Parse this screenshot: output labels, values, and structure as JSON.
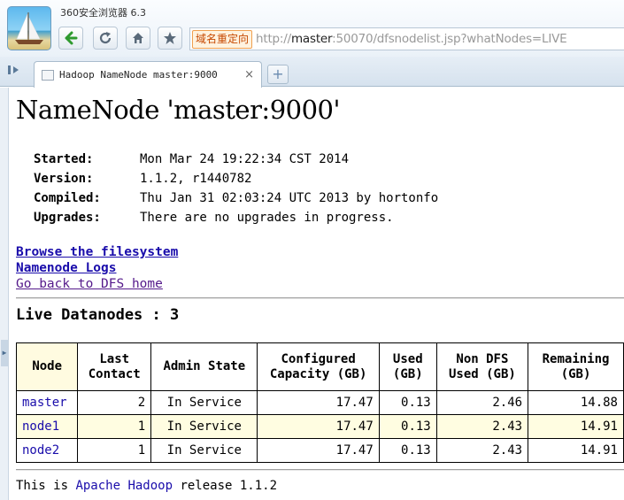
{
  "browser": {
    "title": "360安全浏览器 6.3",
    "redirect_badge": "域名重定向",
    "url_prefix": "http://",
    "url_host": "master",
    "url_rest": ":50070/dfsnodelist.jsp?whatNodes=LIVE",
    "tab_title": "Hadoop NameNode master:9000",
    "tab_close": "×",
    "new_tab": "+",
    "icons": {
      "back": "arrow-left-icon",
      "refresh": "refresh-icon",
      "home": "home-icon",
      "favorite": "star-icon"
    }
  },
  "page": {
    "title": "NameNode 'master:9000'",
    "info": [
      {
        "label": "Started:",
        "value": "Mon Mar 24 19:22:34 CST 2014"
      },
      {
        "label": "Version:",
        "value": "1.1.2, r1440782"
      },
      {
        "label": "Compiled:",
        "value": "Thu Jan 31 02:03:24 UTC 2013 by hortonfo"
      },
      {
        "label": "Upgrades:",
        "value": "There are no upgrades in progress."
      }
    ],
    "links": {
      "browse": "Browse the filesystem",
      "logs": "Namenode Logs",
      "dfs_home": "Go back to DFS home"
    },
    "section_title": "Live Datanodes : 3",
    "columns": {
      "node": "Node",
      "last_contact_1": "Last",
      "last_contact_2": "Contact",
      "admin_state": "Admin State",
      "configured_1": "Configured",
      "configured_2": "Capacity (GB)",
      "used_1": "Used",
      "used_2": "(GB)",
      "nondfs_1": "Non DFS",
      "nondfs_2": "Used (GB)",
      "remaining_1": "Remaining",
      "remaining_2": "(GB)"
    },
    "rows": [
      {
        "node": "master",
        "last_contact": "2",
        "admin_state": "In Service",
        "configured": "17.47",
        "used": "0.13",
        "non_dfs": "2.46",
        "remaining": "14.88"
      },
      {
        "node": "node1",
        "last_contact": "1",
        "admin_state": "In Service",
        "configured": "17.47",
        "used": "0.13",
        "non_dfs": "2.43",
        "remaining": "14.91"
      },
      {
        "node": "node2",
        "last_contact": "1",
        "admin_state": "In Service",
        "configured": "17.47",
        "used": "0.13",
        "non_dfs": "2.43",
        "remaining": "14.91"
      }
    ],
    "footer": {
      "prefix": "This is ",
      "link": "Apache Hadoop",
      "suffix": " release 1.1.2"
    }
  },
  "colors": {
    "link": "#1a0dab",
    "visited_link": "#551a8b",
    "row_highlight": "#fffde1",
    "redirect_badge": "#c64800"
  }
}
